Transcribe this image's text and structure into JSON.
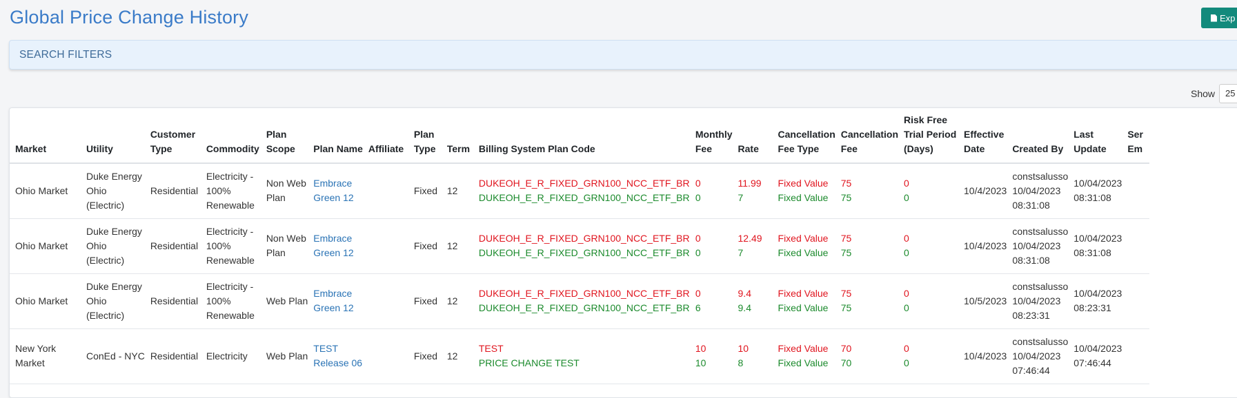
{
  "page": {
    "title": "Global Price Change History",
    "export_label": "Exp",
    "search_filters_label": "SEARCH FILTERS",
    "show_label": "Show",
    "show_value": "25"
  },
  "colors": {
    "title": "#3a7bc8",
    "export": "#138a7c",
    "new_value": "#e0141e",
    "old_value": "#1b8a2c",
    "link": "#2a73b5"
  },
  "table": {
    "headers": [
      [
        "Market"
      ],
      [
        "Utility"
      ],
      [
        "Customer",
        "Type"
      ],
      [
        "Commodity"
      ],
      [
        "Plan",
        "Scope"
      ],
      [
        "Plan Name"
      ],
      [
        "Affiliate"
      ],
      [
        "Plan",
        "Type"
      ],
      [
        "Term"
      ],
      [
        "Billing System Plan Code"
      ],
      [
        "Monthly",
        "Fee"
      ],
      [
        "Rate"
      ],
      [
        "Cancellation",
        "Fee Type"
      ],
      [
        "Cancellation",
        "Fee"
      ],
      [
        "Risk Free",
        "Trial Period",
        "(Days)"
      ],
      [
        "Effective",
        "Date"
      ],
      [
        "Created By"
      ],
      [
        "Last",
        "Update"
      ],
      [
        "Ser",
        "Em"
      ]
    ],
    "rows": [
      {
        "market": [
          "Ohio Market"
        ],
        "utility": [
          "Duke Energy",
          "Ohio",
          "(Electric)"
        ],
        "customer_type": "Residential",
        "commodity": [
          "Electricity -",
          "100%",
          "Renewable"
        ],
        "plan_scope": [
          "Non Web",
          "Plan"
        ],
        "plan_name": [
          "Embrace",
          "Green 12"
        ],
        "affiliate": "",
        "plan_type": "Fixed",
        "term": "12",
        "billing_code": [
          "DUKEOH_E_R_FIXED_GRN100_NCC_ETF_BR",
          "DUKEOH_E_R_FIXED_GRN100_NCC_ETF_BR"
        ],
        "monthly_fee": [
          "0",
          "0"
        ],
        "rate": [
          "11.99",
          "7"
        ],
        "cancel_fee_type": [
          "Fixed Value",
          "Fixed Value"
        ],
        "cancel_fee": [
          "75",
          "75"
        ],
        "risk_free": [
          "0",
          "0"
        ],
        "effective_date": "10/4/2023",
        "created_by": [
          "constsalusso",
          "10/04/2023",
          "08:31:08"
        ],
        "last_update": [
          "10/04/2023",
          "08:31:08"
        ]
      },
      {
        "market": [
          "Ohio Market"
        ],
        "utility": [
          "Duke Energy",
          "Ohio",
          "(Electric)"
        ],
        "customer_type": "Residential",
        "commodity": [
          "Electricity -",
          "100%",
          "Renewable"
        ],
        "plan_scope": [
          "Non Web",
          "Plan"
        ],
        "plan_name": [
          "Embrace",
          "Green 12"
        ],
        "affiliate": "",
        "plan_type": "Fixed",
        "term": "12",
        "billing_code": [
          "DUKEOH_E_R_FIXED_GRN100_NCC_ETF_BR",
          "DUKEOH_E_R_FIXED_GRN100_NCC_ETF_BR"
        ],
        "monthly_fee": [
          "0",
          "0"
        ],
        "rate": [
          "12.49",
          "7"
        ],
        "cancel_fee_type": [
          "Fixed Value",
          "Fixed Value"
        ],
        "cancel_fee": [
          "75",
          "75"
        ],
        "risk_free": [
          "0",
          "0"
        ],
        "effective_date": "10/4/2023",
        "created_by": [
          "constsalusso",
          "10/04/2023",
          "08:31:08"
        ],
        "last_update": [
          "10/04/2023",
          "08:31:08"
        ]
      },
      {
        "market": [
          "Ohio Market"
        ],
        "utility": [
          "Duke Energy",
          "Ohio",
          "(Electric)"
        ],
        "customer_type": "Residential",
        "commodity": [
          "Electricity -",
          "100%",
          "Renewable"
        ],
        "plan_scope": [
          "Web Plan"
        ],
        "plan_name": [
          "Embrace",
          "Green 12"
        ],
        "affiliate": "",
        "plan_type": "Fixed",
        "term": "12",
        "billing_code": [
          "DUKEOH_E_R_FIXED_GRN100_NCC_ETF_BR",
          "DUKEOH_E_R_FIXED_GRN100_NCC_ETF_BR"
        ],
        "monthly_fee": [
          "0",
          "6"
        ],
        "rate": [
          "9.4",
          "9.4"
        ],
        "cancel_fee_type": [
          "Fixed Value",
          "Fixed Value"
        ],
        "cancel_fee": [
          "75",
          "75"
        ],
        "risk_free": [
          "0",
          "0"
        ],
        "effective_date": "10/5/2023",
        "created_by": [
          "constsalusso",
          "10/04/2023",
          "08:23:31"
        ],
        "last_update": [
          "10/04/2023",
          "08:23:31"
        ]
      },
      {
        "market": [
          "New York",
          "Market"
        ],
        "utility": [
          "ConEd - NYC"
        ],
        "customer_type": "Residential",
        "commodity": [
          "Electricity"
        ],
        "plan_scope": [
          "Web Plan"
        ],
        "plan_name": [
          "TEST",
          "Release 06"
        ],
        "affiliate": "",
        "plan_type": "Fixed",
        "term": "12",
        "billing_code": [
          "TEST",
          "PRICE CHANGE TEST"
        ],
        "monthly_fee": [
          "10",
          "10"
        ],
        "rate": [
          "10",
          "8"
        ],
        "cancel_fee_type": [
          "Fixed Value",
          "Fixed Value"
        ],
        "cancel_fee": [
          "70",
          "70"
        ],
        "risk_free": [
          "0",
          "0"
        ],
        "effective_date": "10/4/2023",
        "created_by": [
          "constsalusso",
          "10/04/2023",
          "07:46:44"
        ],
        "last_update": [
          "10/04/2023",
          "07:46:44"
        ]
      }
    ]
  }
}
